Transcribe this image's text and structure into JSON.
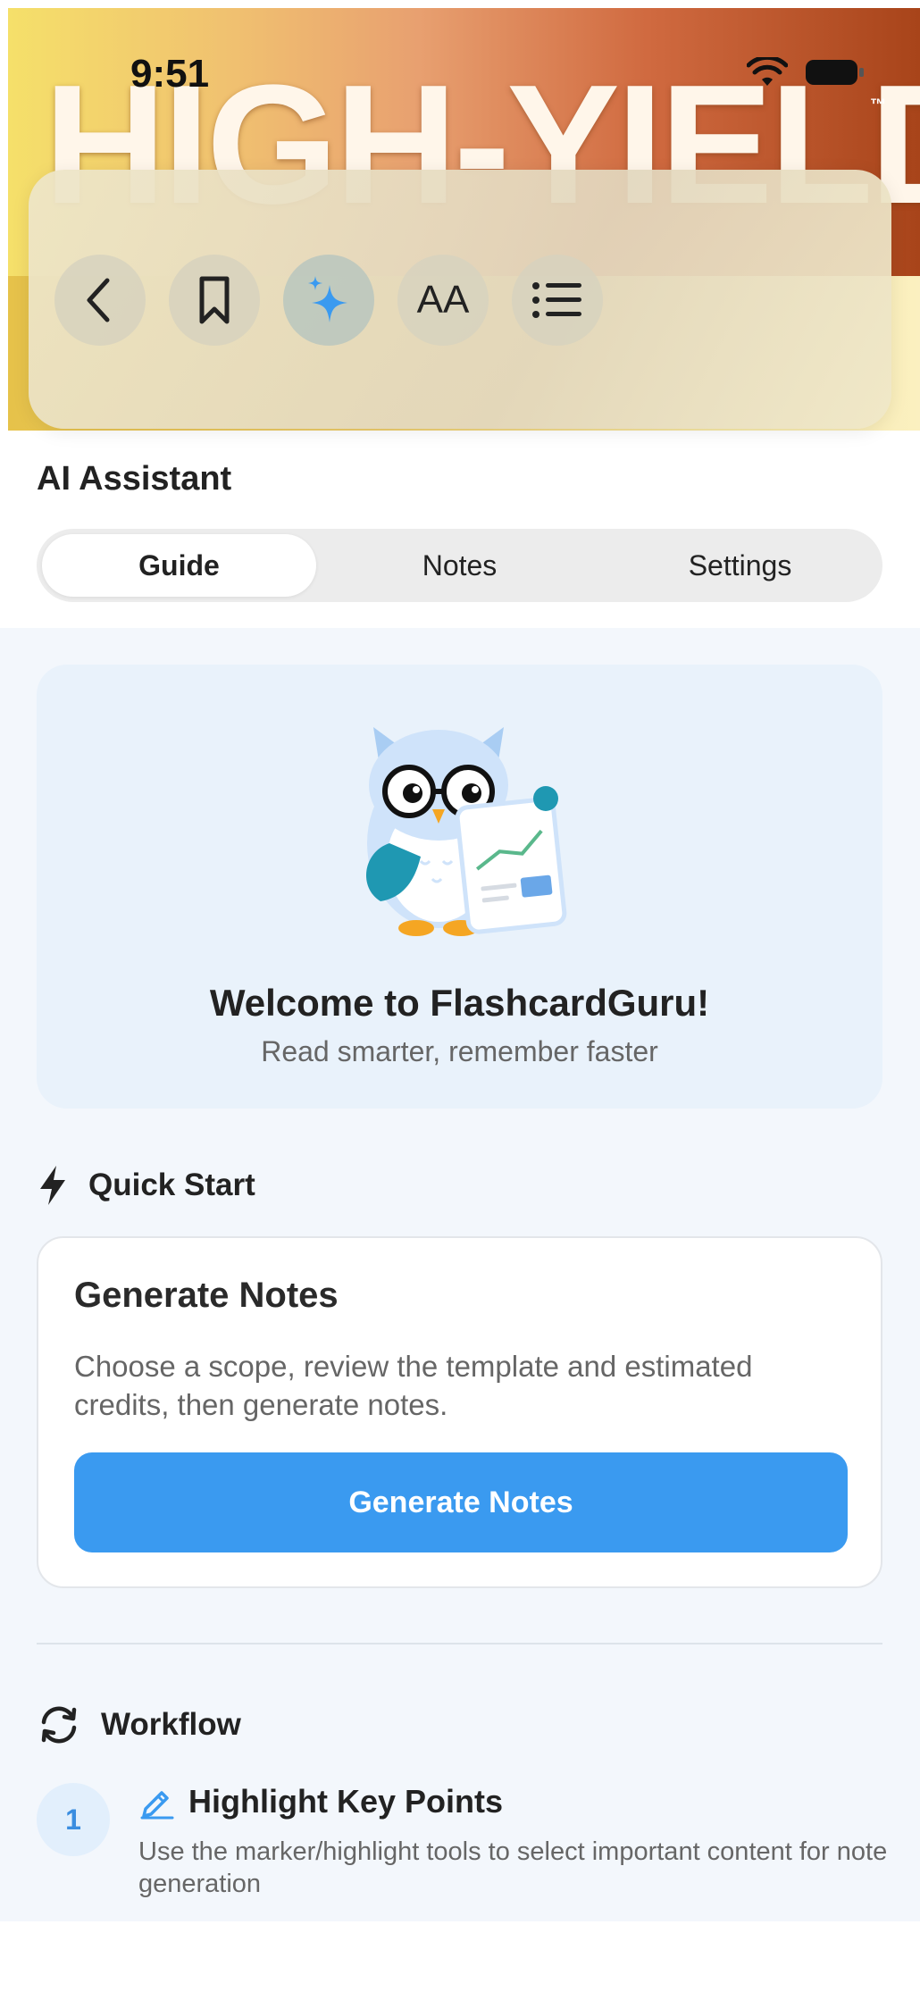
{
  "status_bar": {
    "time": "9:51"
  },
  "cover": {
    "title": "HIGH-YIELD",
    "trademark": "™"
  },
  "toolbar": {
    "buttons": [
      {
        "name": "back",
        "icon": "chevron-left-icon"
      },
      {
        "name": "bookmark",
        "icon": "bookmark-icon"
      },
      {
        "name": "ai",
        "icon": "sparkle-icon",
        "active": true
      },
      {
        "name": "text-size",
        "label": "AA",
        "icon": "text-size-icon"
      },
      {
        "name": "contents",
        "icon": "list-icon"
      }
    ]
  },
  "assistant": {
    "title": "AI Assistant",
    "tabs": [
      {
        "label": "Guide",
        "active": true
      },
      {
        "label": "Notes",
        "active": false
      },
      {
        "label": "Settings",
        "active": false
      }
    ]
  },
  "welcome": {
    "title": "Welcome to FlashcardGuru!",
    "subtitle": "Read smarter, remember faster"
  },
  "quick_start": {
    "heading": "Quick Start",
    "card_title": "Generate Notes",
    "card_description": "Choose a scope, review the template and estimated credits, then generate notes.",
    "button_label": "Generate Notes"
  },
  "workflow": {
    "heading": "Workflow",
    "steps": [
      {
        "number": "1",
        "title": "Highlight Key Points",
        "description": "Use the marker/highlight tools to select important content for note generation"
      }
    ]
  },
  "colors": {
    "accent": "#3a9af0",
    "panel_bg": "#f3f7fc",
    "welcome_bg": "#e9f2fb"
  }
}
